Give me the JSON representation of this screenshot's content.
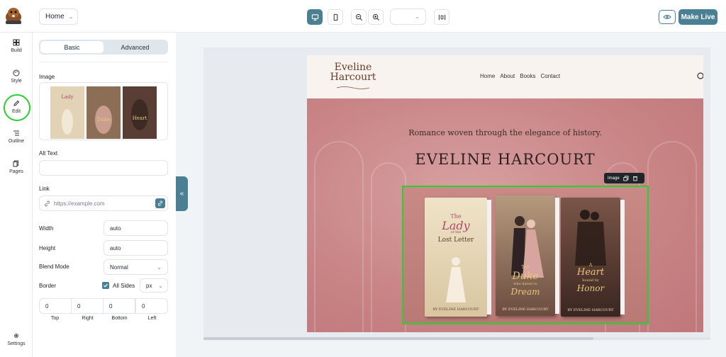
{
  "topbar": {
    "page_select": "Home",
    "make_live": "Make Live"
  },
  "rail": {
    "build": "Build",
    "style": "Style",
    "edit": "Edit",
    "outline": "Outline",
    "pages": "Pages",
    "settings": "Settings"
  },
  "panel": {
    "tab_basic": "Basic",
    "tab_advanced": "Advanced",
    "image_label": "Image",
    "alt_label": "Alt Text",
    "alt_value": "",
    "link_label": "Link",
    "link_placeholder": "https://example.com",
    "width_label": "Width",
    "width_value": "auto",
    "height_label": "Height",
    "height_value": "auto",
    "blend_label": "Blend Mode",
    "blend_value": "Normal",
    "border_label": "Border",
    "all_sides": "All Sides",
    "unit": "px",
    "sides": {
      "top": "0",
      "right": "0",
      "bottom": "0",
      "left": "0",
      "top_label": "Top",
      "right_label": "Right",
      "bottom_label": "Bottom",
      "left_label": "Left"
    }
  },
  "site": {
    "brand_line1": "Eveline",
    "brand_line2": "Harcourt",
    "nav": [
      "Home",
      "About",
      "Books",
      "Contact"
    ],
    "tagline": "Romance woven through the elegance of history.",
    "title": "EVELINE HARCOURT",
    "selection_chip": "Image",
    "books": [
      {
        "title_small": "The",
        "title_big": "Lady",
        "title_mid": "of the",
        "title_end": "Lost Letter",
        "author": "BY EVELINE HARCOURT"
      },
      {
        "title_small": "The",
        "title_big": "Duke",
        "title_mid": "who dared to",
        "title_end": "Dream",
        "author": "BY EVELINE HARCOURT"
      },
      {
        "title_small": "A",
        "title_big": "Heart",
        "title_mid": "bound by",
        "title_end": "Honor",
        "author": "BY EVELINE HARCOURT"
      }
    ]
  },
  "colors": {
    "accent": "#4b8094",
    "selection": "#27d12f"
  }
}
